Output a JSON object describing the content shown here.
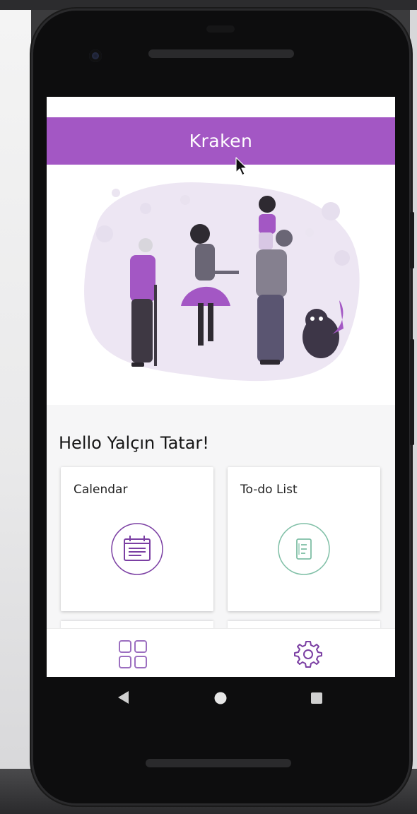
{
  "app": {
    "title": "Kraken"
  },
  "home": {
    "greeting": "Hello Yalçın Tatar!"
  },
  "cards": [
    {
      "label": "Calendar",
      "icon": "calendar-icon"
    },
    {
      "label": "To-do List",
      "icon": "todo-list-icon"
    }
  ],
  "bottom_nav": [
    {
      "icon": "dashboard-grid-icon"
    },
    {
      "icon": "settings-gear-icon"
    }
  ],
  "android_nav": [
    {
      "icon": "back-triangle-icon"
    },
    {
      "icon": "home-circle-icon"
    },
    {
      "icon": "recents-square-icon"
    }
  ],
  "colors": {
    "accent": "#a357c4",
    "icon_purple": "#7b3fa3",
    "icon_teal": "#7fbfa6",
    "illustration_light": "#ece6f2"
  }
}
